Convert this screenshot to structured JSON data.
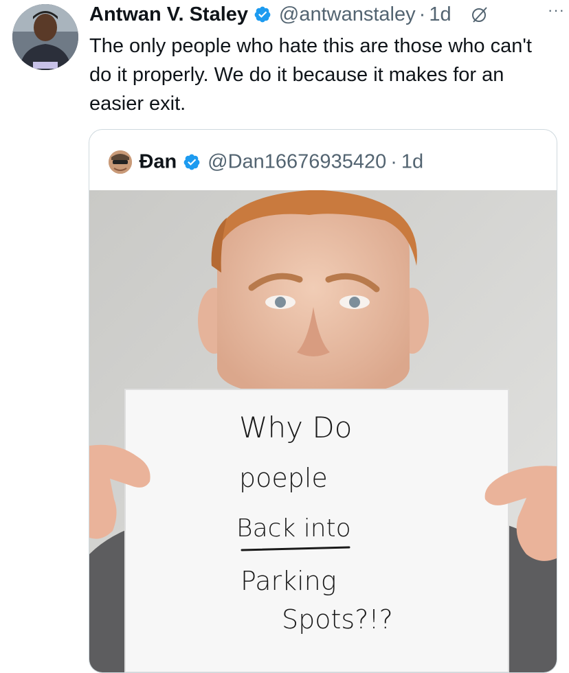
{
  "tweet": {
    "author_name": "Antwan V. Staley",
    "handle": "@antwanstaley",
    "separator": "·",
    "time": "1d",
    "more_label": "···",
    "text": "The only people who hate this are those who can't do it properly. We do it because it makes for an easier exit."
  },
  "quoted_tweet": {
    "author_name": "Đan",
    "handle": "@Dan16676935420",
    "separator": "·",
    "time": "1d",
    "sign": {
      "line1": "Why Do",
      "line2": "poeple",
      "line3": "Back into",
      "line4": "Parking",
      "line5": "Spots?!?"
    }
  },
  "colors": {
    "verified": "#1d9bf0",
    "secondary_text": "#536471",
    "border": "#cfd9de"
  },
  "icons": [
    "verified-badge-icon",
    "grok-icon",
    "more-icon"
  ]
}
